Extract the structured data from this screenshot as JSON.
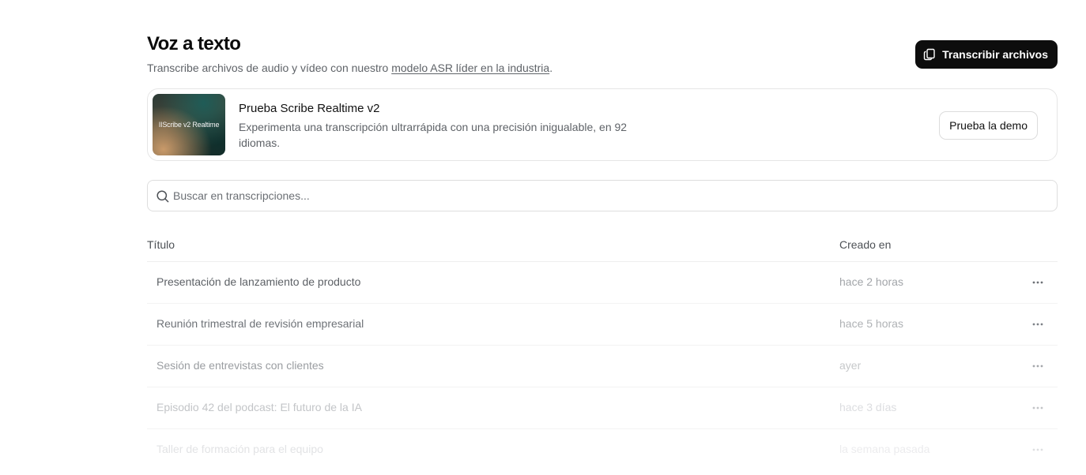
{
  "header": {
    "title": "Voz a texto",
    "subtitle_prefix": "Transcribe archivos de audio y vídeo con nuestro ",
    "subtitle_link": "modelo ASR líder en la industria",
    "subtitle_suffix": ".",
    "transcribe_button": "Transcribir archivos",
    "transcribe_icon": "copy-files-icon"
  },
  "promo": {
    "thumbnail_text": "IIScribe v2 Realtime",
    "title": "Prueba Scribe Realtime v2",
    "description": "Experimenta una transcripción ultrarrápida con una precisión inigualable, en 92 idiomas.",
    "demo_button": "Prueba la demo"
  },
  "search": {
    "placeholder": "Buscar en transcripciones...",
    "value": "",
    "icon": "search-icon"
  },
  "table": {
    "columns": [
      "Título",
      "Creado en"
    ],
    "rows": [
      {
        "title": "Presentación de lanzamiento de producto",
        "created": "hace 2 horas"
      },
      {
        "title": "Reunión trimestral de revisión empresarial",
        "created": "hace 5 horas"
      },
      {
        "title": "Sesión de entrevistas con clientes",
        "created": "ayer"
      },
      {
        "title": "Episodio 42 del podcast: El futuro de la IA",
        "created": "hace 3 días"
      },
      {
        "title": "Taller de formación para el equipo",
        "created": "la semana pasada"
      }
    ],
    "row_menu_icon": "more-horizontal-icon"
  },
  "colors": {
    "primary_button_bg": "#0d0d0d",
    "text_muted": "#5f6368",
    "border": "#e6e6e6"
  }
}
